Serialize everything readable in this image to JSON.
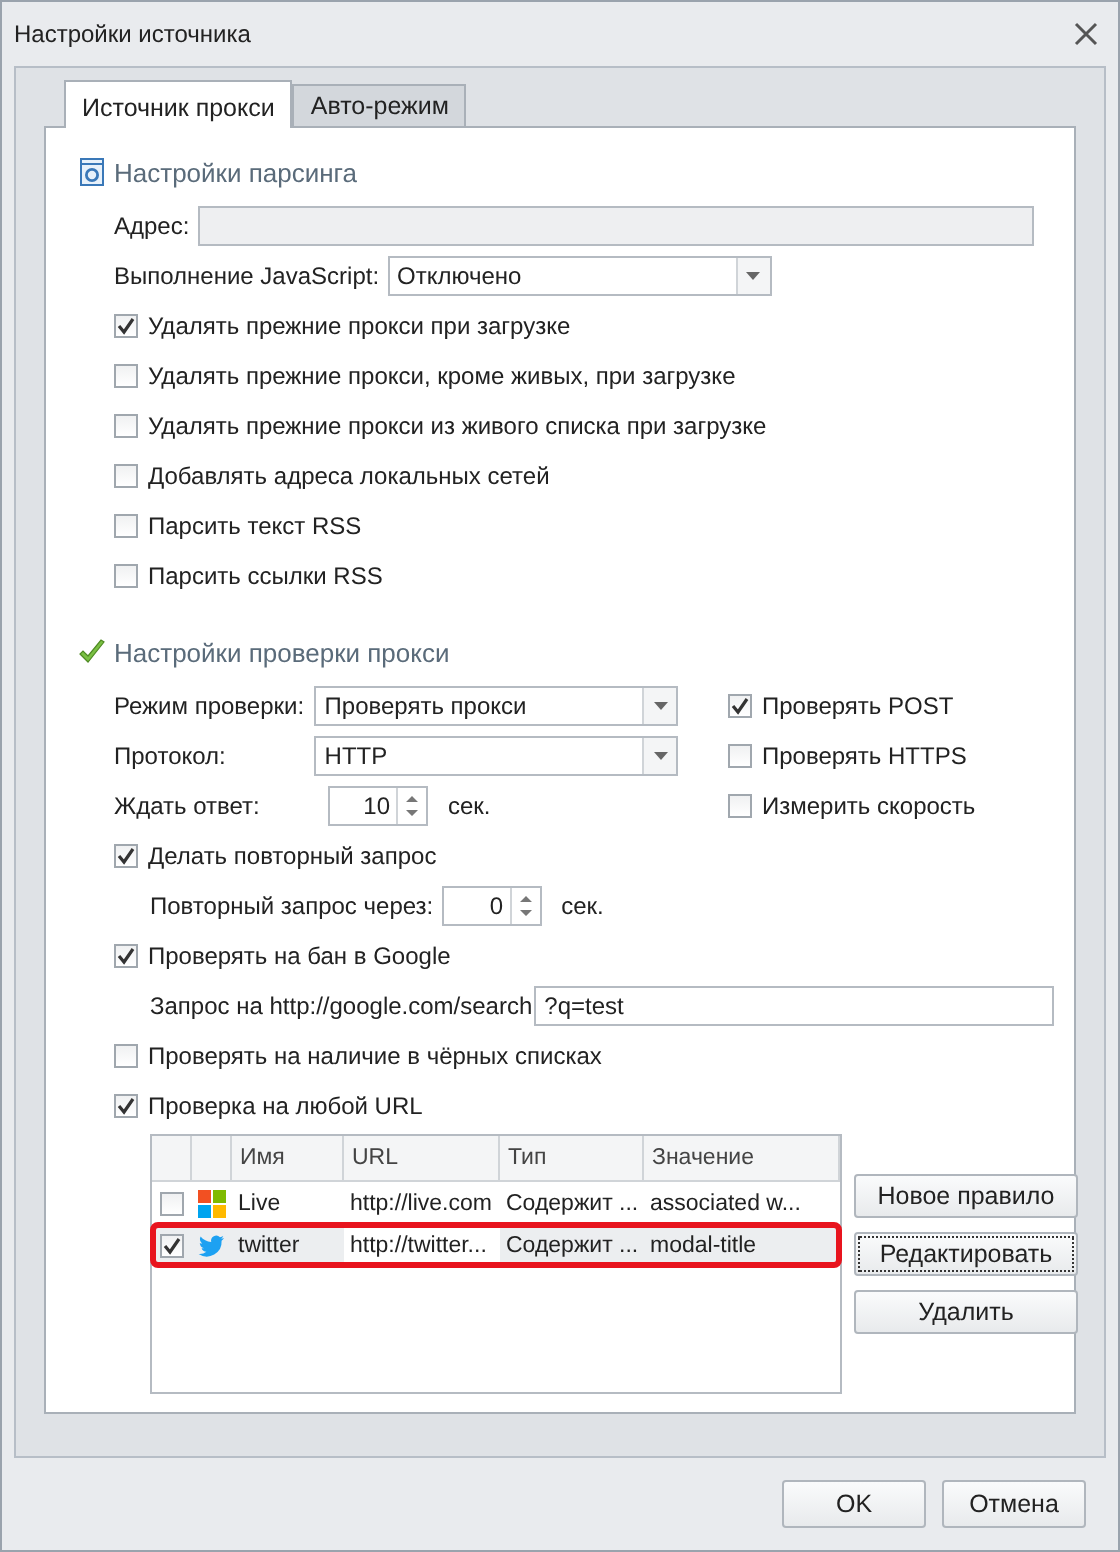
{
  "window": {
    "title": "Настройки источника"
  },
  "tabs": [
    {
      "label": "Источник прокси",
      "selected": true
    },
    {
      "label": "Авто-режим",
      "selected": false
    }
  ],
  "parsing": {
    "title": "Настройки парсинга",
    "address": {
      "label": "Адрес:",
      "disabled": true
    },
    "javascript": {
      "label": "Выполнение JavaScript:",
      "value": "Отключено"
    },
    "options": [
      {
        "label": "Удалять прежние прокси при загрузке",
        "checked": true
      },
      {
        "label": "Удалять прежние прокси, кроме живых, при загрузке",
        "checked": false
      },
      {
        "label": "Удалять прежние прокси из живого списка при загрузке",
        "checked": false
      },
      {
        "label": "Добавлять адреса локальных сетей",
        "checked": false
      },
      {
        "label": "Парсить текст RSS",
        "checked": false
      },
      {
        "label": "Парсить ссылки RSS",
        "checked": false
      }
    ]
  },
  "checking": {
    "title": "Настройки проверки прокси",
    "mode": {
      "label": "Режим проверки:",
      "value": "Проверять прокси"
    },
    "protocol": {
      "label": "Протокол:",
      "value": "HTTP"
    },
    "wait": {
      "label": "Ждать ответ:",
      "value": "10",
      "unit": "сек."
    },
    "side_options": [
      {
        "label": "Проверять POST",
        "checked": true
      },
      {
        "label": "Проверять HTTPS",
        "checked": false
      },
      {
        "label": "Измерить скорость",
        "checked": false
      }
    ],
    "retry": {
      "label": "Делать повторный запрос",
      "checked": true
    },
    "retry_delay": {
      "label": "Повторный запрос через:",
      "value": "0",
      "unit": "сек."
    },
    "google": {
      "label": "Проверять на бан в Google",
      "checked": true
    },
    "google_query": {
      "label": "Запрос на http://google.com/search",
      "value": "?q=test"
    },
    "blacklist": {
      "label": "Проверять на наличие в чёрных списках",
      "checked": false
    },
    "any_url": {
      "label": "Проверка на любой URL",
      "checked": true
    },
    "rules": {
      "columns": [
        "Имя",
        "URL",
        "Тип",
        "Значение"
      ],
      "rows": [
        {
          "checked": false,
          "kind": "windows",
          "name": "Live",
          "url": "http://live.com",
          "type": "Содержит ...",
          "value": "associated w...",
          "selected": false
        },
        {
          "checked": true,
          "kind": "bird",
          "name": "twitter",
          "url": "http://twitter...",
          "type": "Содержит ...",
          "value": "modal-title",
          "selected": true
        }
      ]
    },
    "rule_buttons": [
      {
        "label": "Новое правило",
        "focused": false
      },
      {
        "label": "Редактировать",
        "focused": true
      },
      {
        "label": "Удалить",
        "focused": false
      }
    ]
  },
  "buttons": [
    "OK",
    "Отмена"
  ]
}
